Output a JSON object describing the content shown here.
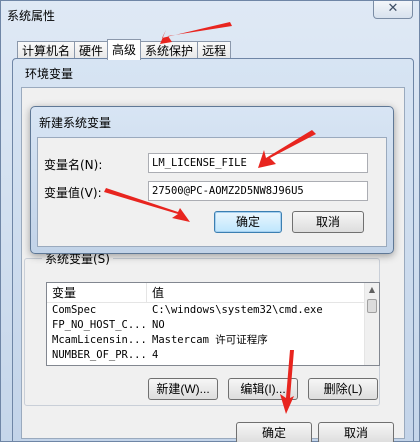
{
  "system_properties": {
    "title": "系统属性",
    "close_glyph": "✕",
    "tabs": [
      {
        "label": "计算机名"
      },
      {
        "label": "硬件"
      },
      {
        "label": "高级"
      },
      {
        "label": "系统保护"
      },
      {
        "label": "远程"
      }
    ],
    "active_tab": 2
  },
  "env_vars": {
    "title": "环境变量",
    "system_group_label": "系统变量(S)",
    "columns": [
      "变量",
      "值"
    ],
    "rows": [
      {
        "name": "ComSpec",
        "value": "C:\\windows\\system32\\cmd.exe"
      },
      {
        "name": "FP_NO_HOST_C...",
        "value": "NO"
      },
      {
        "name": "McamLicensin...",
        "value": "Mastercam 许可证程序"
      },
      {
        "name": "NUMBER_OF_PR...",
        "value": "4"
      }
    ],
    "new_label": "新建(W)...",
    "edit_label": "编辑(I)...",
    "delete_label": "删除(L)",
    "ok_label": "确定",
    "cancel_label": "取消"
  },
  "new_var": {
    "title": "新建系统变量",
    "name_label": "变量名(N):",
    "name_value": "LM_LICENSE_FILE",
    "value_label": "变量值(V):",
    "value_value": "27500@PC-AOMZ2D5NW8J96U5",
    "ok_label": "确定",
    "cancel_label": "取消"
  },
  "colors": {
    "annotation_arrow": "#e8251f",
    "window_frame": "#c5d6ea",
    "default_button": "#bee6fd"
  }
}
